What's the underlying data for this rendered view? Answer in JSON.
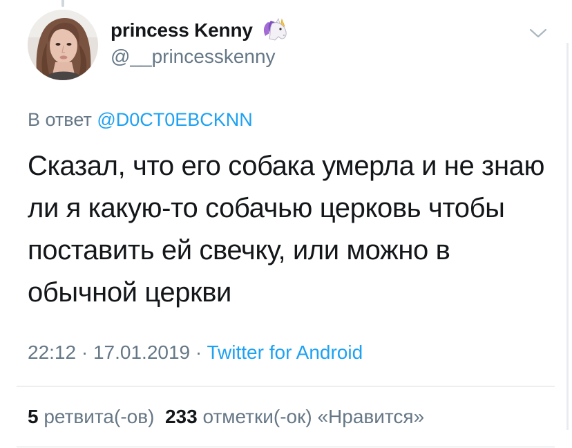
{
  "tweet": {
    "author": {
      "display_name": "princess Kenny",
      "name_emoji": "unicorn-icon",
      "handle": "@__princesskenny"
    },
    "reply": {
      "prefix": "В ответ",
      "mention": "@D0CT0EBCKNN"
    },
    "text": "Сказал, что его собака умерла и не знаю ли я какую-то собачью церковь чтобы поставить ей свечку, или можно в обычной церкви",
    "time": "22:12",
    "sep1": "·",
    "date": "17.01.2019",
    "sep2": "·",
    "source": "Twitter for Android",
    "stats": {
      "retweets_count": "5",
      "retweets_label": "ретвита(-ов)",
      "likes_count": "233",
      "likes_label": "отметки(-ок) «Нравится»"
    }
  },
  "colors": {
    "text": "#14171a",
    "secondary": "#657786",
    "link": "#1da1f2",
    "divider": "#d6dadf"
  },
  "icons": {
    "menu": "chevron-down-icon",
    "emoji": "unicorn-icon"
  }
}
